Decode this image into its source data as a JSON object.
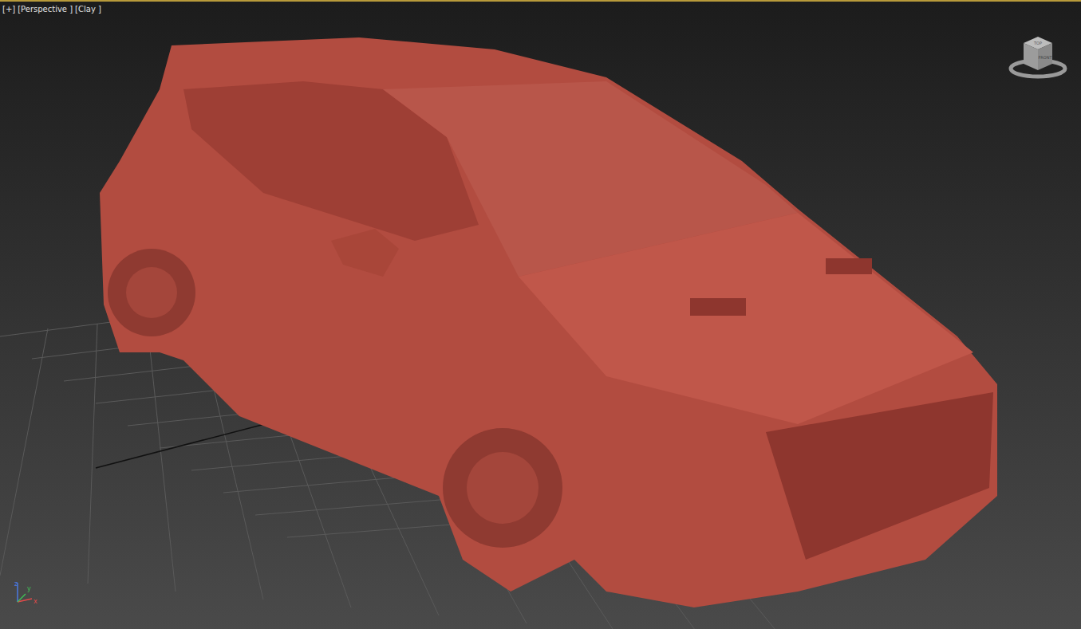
{
  "viewport": {
    "labels": [
      "[+]",
      "[Perspective ]",
      "[Clay ]"
    ],
    "active": true
  },
  "viewcube": {
    "faces": [
      "TOP",
      "FRONT"
    ]
  },
  "axis": [
    {
      "label": "z",
      "color": "#4a78e0"
    },
    {
      "label": "x",
      "color": "#e04a4a"
    },
    {
      "label": "y",
      "color": "#3fbf55"
    }
  ]
}
